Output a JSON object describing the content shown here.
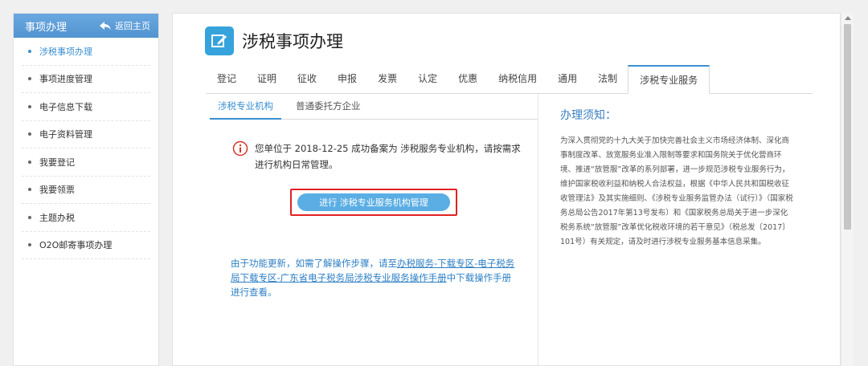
{
  "sidebar": {
    "title": "事项办理",
    "back_label": "返回主页",
    "items": [
      {
        "label": "涉税事项办理"
      },
      {
        "label": "事项进度管理"
      },
      {
        "label": "电子信息下载"
      },
      {
        "label": "电子资料管理"
      },
      {
        "label": "我要登记"
      },
      {
        "label": "我要领票"
      },
      {
        "label": "主题办税"
      },
      {
        "label": "O2O邮寄事项办理"
      }
    ]
  },
  "main": {
    "title": "涉税事项办理",
    "tabs": [
      "登记",
      "证明",
      "征收",
      "申报",
      "发票",
      "认定",
      "优惠",
      "纳税信用",
      "通用",
      "法制",
      "涉税专业服务"
    ],
    "subtabs": [
      "涉税专业机构",
      "普通委托方企业"
    ],
    "notice": "您单位于 2018-12-25 成功备案为 涉税服务专业机构，请按需求进行机构日常管理。",
    "action_button": "进行 涉税专业服务机构管理",
    "help": {
      "prefix": "由于功能更新，如需了解操作步骤，请至",
      "link": "办税服务-下载专区-电子税务局下载专区-广东省电子税务局涉税专业服务操作手册",
      "suffix": "中下载操作手册进行查看。"
    }
  },
  "instructions": {
    "heading": "办理须知：",
    "body": "为深入贯彻党的十九大关于加快完善社会主义市场经济体制、深化商事制度改革、放宽服务业准入限制等要求和国务院关于优化营商环境、推进“放管服”改革的系列部署，进一步规范涉税专业服务行为，维护国家税收利益和纳税人合法权益，根据《中华人民共和国税收征收管理法》及其实施细则、《涉税专业服务监管办法（试行）》（国家税务总局公告2017年第13号发布）和《国家税务总局关于进一步深化税务系统“放管服”改革优化税收环境的若干意见》（税总发〔2017〕101号）有关规定，请及时进行涉税专业服务基本信息采集。"
  },
  "colors": {
    "accent": "#3a8fd1",
    "header": "#5b9bd5",
    "highlight": "#e12222",
    "link": "#2e7fc4"
  }
}
